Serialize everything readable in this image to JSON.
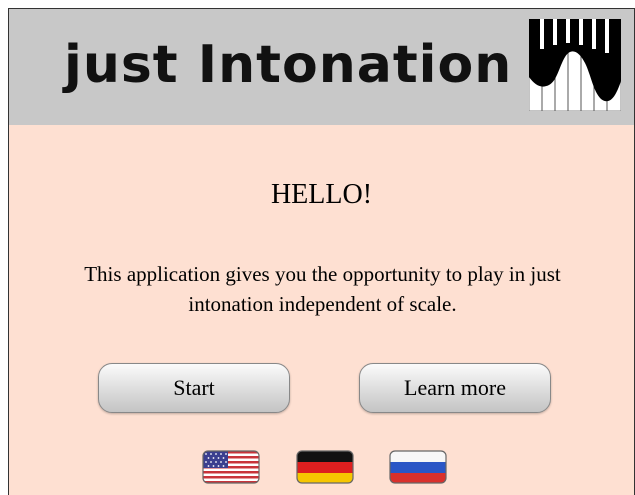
{
  "header": {
    "title": "just Intonation",
    "logo_icon": "piano-keys-logo-icon",
    "background_color": "#c8c8c8"
  },
  "main": {
    "background_color": "#fee0d2",
    "greeting": "HELLO!",
    "description": "This application gives you the opportunity to play in just intonation independent of scale."
  },
  "buttons": {
    "start_label": "Start",
    "learn_more_label": "Learn more"
  },
  "languages": [
    {
      "name": "us-flag-icon"
    },
    {
      "name": "german-flag-icon"
    },
    {
      "name": "russian-flag-icon"
    }
  ]
}
